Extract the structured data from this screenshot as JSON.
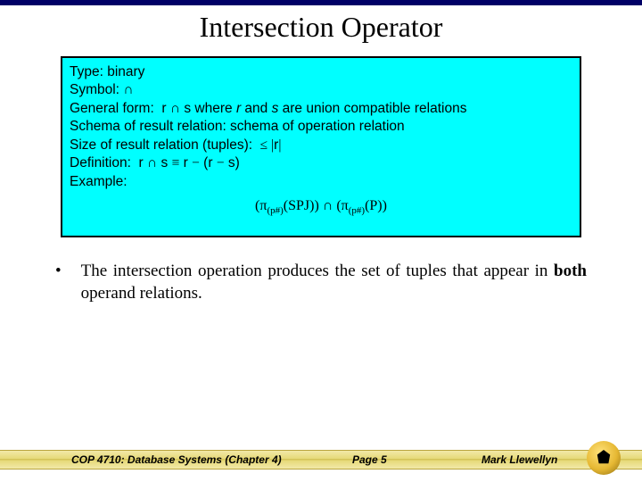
{
  "title": "Intersection Operator",
  "defbox": {
    "type_line": "Type: binary",
    "symbol_line": "Symbol: ∩",
    "general_line": "General form:  r ∩ s where r and s are union compatible relations",
    "schema_line": "Schema of result relation: schema of operation relation",
    "size_line": "Size of result relation (tuples):  ≤ |r|",
    "def_line": "Definition:  r ∩ s ≡ r − (r − s)",
    "example_label": "Example:",
    "example_expr": "(π(p#)(SPJ)) ∩ (π(p#)(P))"
  },
  "bullet": {
    "mark": "•",
    "text_pre": "The intersection operation produces the set of tuples that appear in ",
    "text_bold": "both",
    "text_post": " operand relations."
  },
  "footer": {
    "left": "COP 4710: Database Systems  (Chapter 4)",
    "mid": "Page 5",
    "right": "Mark Llewellyn"
  }
}
